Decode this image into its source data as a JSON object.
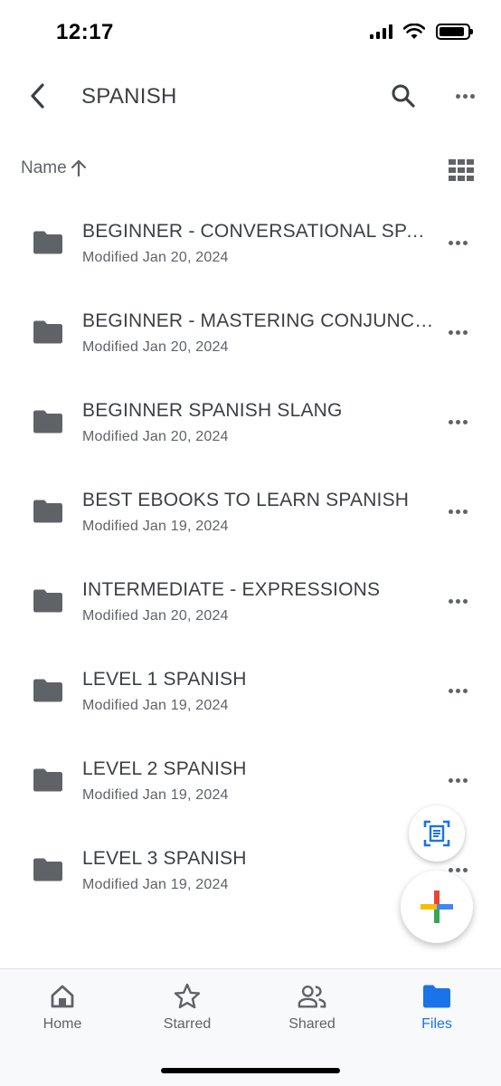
{
  "status_bar": {
    "time": "12:17",
    "battery_level": 0.9
  },
  "header": {
    "title": "SPANISH",
    "back_icon": "chevron-left-icon",
    "search_icon": "search-icon",
    "more_icon": "more-horizontal-icon"
  },
  "sort": {
    "label": "Name",
    "direction_icon": "arrow-up-icon",
    "view_toggle_icon": "grid-view-icon"
  },
  "files": [
    {
      "name": "BEGINNER - CONVERSATIONAL SPANISH",
      "modified": "Modified Jan 20, 2024"
    },
    {
      "name": "BEGINNER - MASTERING CONJUNCTIONS",
      "modified": "Modified Jan 20, 2024"
    },
    {
      "name": "BEGINNER SPANISH SLANG",
      "modified": "Modified Jan 20, 2024"
    },
    {
      "name": "BEST EBOOKS TO LEARN SPANISH",
      "modified": "Modified Jan 19, 2024"
    },
    {
      "name": "INTERMEDIATE - EXPRESSIONS",
      "modified": "Modified Jan 20, 2024"
    },
    {
      "name": "LEVEL 1 SPANISH",
      "modified": "Modified Jan 19, 2024"
    },
    {
      "name": "LEVEL 2 SPANISH",
      "modified": "Modified Jan 19, 2024"
    },
    {
      "name": "LEVEL 3 SPANISH",
      "modified": "Modified Jan 19, 2024"
    }
  ],
  "fabs": {
    "scan_icon": "document-scan-icon",
    "add_icon": "plus-icon"
  },
  "bottom_nav": [
    {
      "label": "Home",
      "icon": "home-icon",
      "active": false
    },
    {
      "label": "Starred",
      "icon": "star-icon",
      "active": false
    },
    {
      "label": "Shared",
      "icon": "people-icon",
      "active": false
    },
    {
      "label": "Files",
      "icon": "folder-icon",
      "active": true
    }
  ],
  "colors": {
    "accent": "#1a73e8",
    "text_primary": "#3c4043",
    "text_secondary": "#5f6368",
    "folder": "#5f6368",
    "google_blue": "#4285f4",
    "google_red": "#ea4335",
    "google_yellow": "#fbbc04",
    "google_green": "#34a853"
  }
}
